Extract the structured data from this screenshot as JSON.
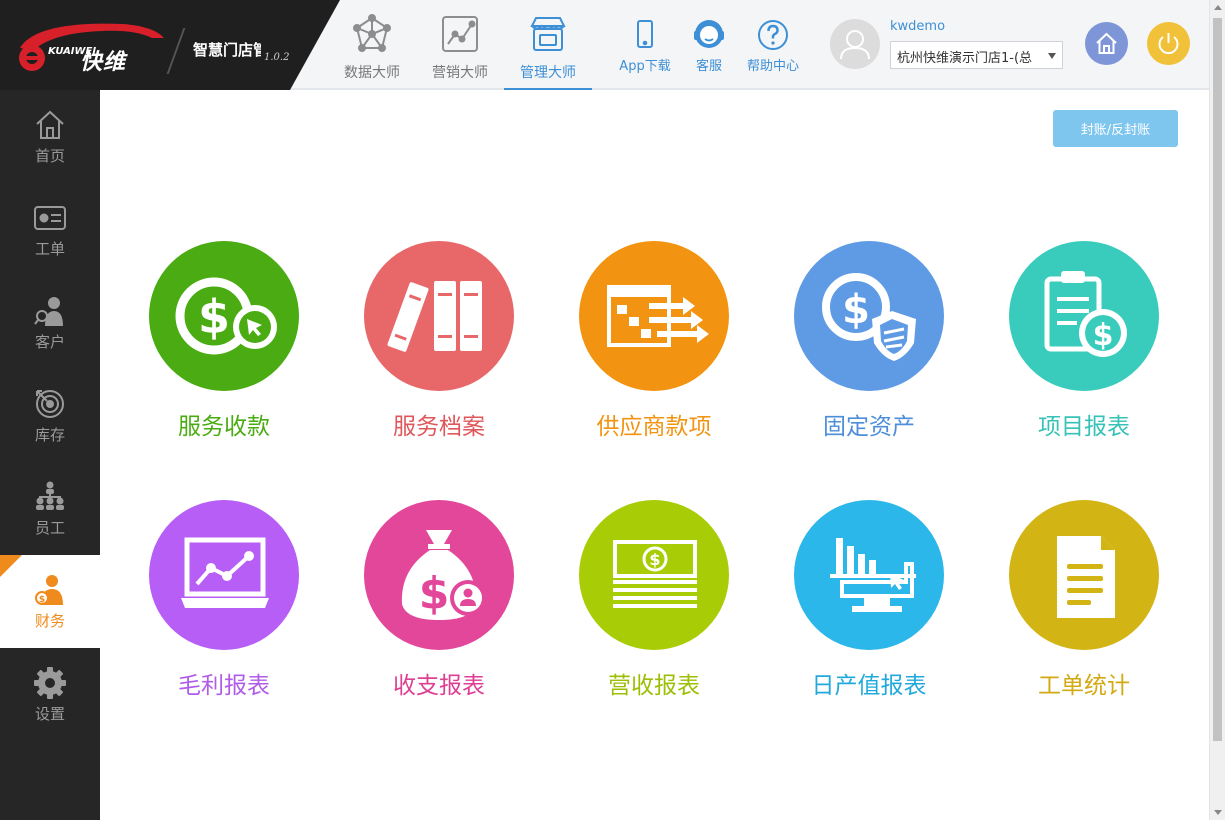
{
  "brand": {
    "name": "快维",
    "latin": "KUAIWEI",
    "app_title": "智慧门店管",
    "version": "1.0.2"
  },
  "nav_tabs": [
    {
      "label": "数据大师",
      "icon": "network-icon",
      "active": false
    },
    {
      "label": "营销大师",
      "icon": "chart-line-icon",
      "active": false
    },
    {
      "label": "管理大师",
      "icon": "storefront-icon",
      "active": true
    }
  ],
  "tools": {
    "app_download": "App下载",
    "customer_service": "客服",
    "help_center": "帮助中心"
  },
  "user": {
    "name": "kwdemo",
    "store": "杭州快维演示门店1-(总"
  },
  "sidebar": {
    "items": [
      {
        "label": "首页",
        "icon": "home-icon",
        "active": false
      },
      {
        "label": "工单",
        "icon": "work-order-icon",
        "active": false
      },
      {
        "label": "客户",
        "icon": "customer-icon",
        "active": false
      },
      {
        "label": "库存",
        "icon": "inventory-icon",
        "active": false
      },
      {
        "label": "员工",
        "icon": "org-chart-icon",
        "active": false
      },
      {
        "label": "财务",
        "icon": "finance-icon",
        "active": true
      },
      {
        "label": "设置",
        "icon": "gear-icon",
        "active": false
      }
    ]
  },
  "main": {
    "seal_button": "封账/反封账",
    "tiles": [
      {
        "label": "服务收款",
        "color": "#4aab13",
        "text_color": "#4aab13",
        "icon": "dollar-cursor-icon"
      },
      {
        "label": "服务档案",
        "color": "#e86769",
        "text_color": "#e0575b",
        "icon": "binders-icon"
      },
      {
        "label": "供应商款项",
        "color": "#f29411",
        "text_color": "#f29411",
        "icon": "supplier-flow-icon"
      },
      {
        "label": "固定资产",
        "color": "#5e9be4",
        "text_color": "#4d8ed9",
        "icon": "dollar-shield-icon"
      },
      {
        "label": "项目报表",
        "color": "#39ccbc",
        "text_color": "#36c2b6",
        "icon": "clipboard-dollar-icon"
      },
      {
        "label": "毛利报表",
        "color": "#b65ef6",
        "text_color": "#b15ce8",
        "icon": "laptop-chart-icon"
      },
      {
        "label": "收支报表",
        "color": "#e3479a",
        "text_color": "#de3f93",
        "icon": "money-bag-icon"
      },
      {
        "label": "营收报表",
        "color": "#a8cc06",
        "text_color": "#9cbf06",
        "icon": "cash-stack-icon"
      },
      {
        "label": "日产值报表",
        "color": "#2bb7ea",
        "text_color": "#22a9dc",
        "icon": "monitor-bars-icon"
      },
      {
        "label": "工单统计",
        "color": "#d2b415",
        "text_color": "#d2aa13",
        "icon": "document-icon"
      }
    ]
  },
  "colors": {
    "accent": "#3d8fd6",
    "finance_active": "#ef8a1c",
    "home_button": "#7e96d8",
    "power_button": "#f2c13a"
  }
}
